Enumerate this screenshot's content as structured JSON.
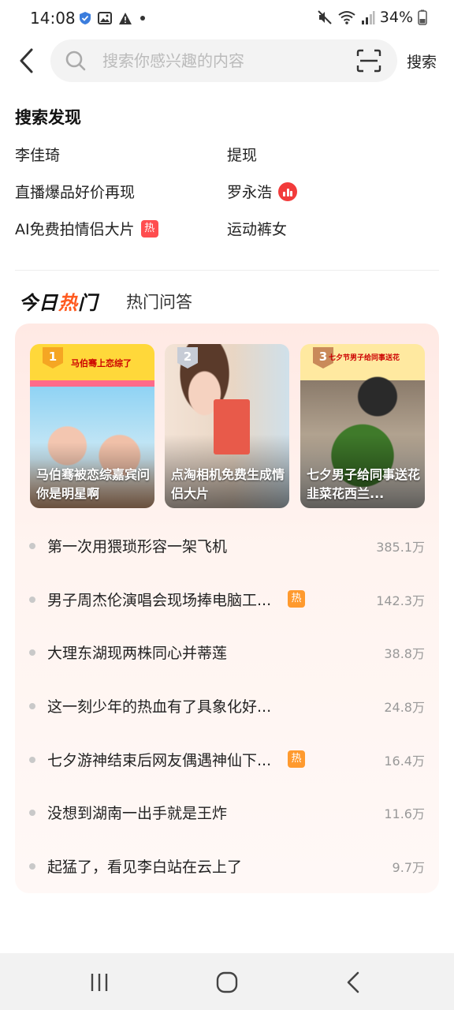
{
  "status_bar": {
    "time": "14:08",
    "battery": "34%",
    "left_icons": [
      "shield-icon",
      "image-icon",
      "warning-icon",
      "dot-icon"
    ],
    "right_icons": [
      "mute-icon",
      "wifi-icon",
      "signal-icon",
      "battery-icon"
    ]
  },
  "search": {
    "placeholder": "搜索你感兴趣的内容",
    "button_label": "搜索"
  },
  "discovery": {
    "title": "搜索发现",
    "items": [
      {
        "label": "李佳琦",
        "badge": ""
      },
      {
        "label": "提现",
        "badge": ""
      },
      {
        "label": "直播爆品好价再现",
        "badge": ""
      },
      {
        "label": "罗永浩",
        "badge": "live"
      },
      {
        "label": "AI免费拍情侣大片",
        "badge": "热"
      },
      {
        "label": "运动裤女",
        "badge": ""
      }
    ]
  },
  "tabs": {
    "active_part1": "今日",
    "active_part2": "热",
    "active_part3": "门",
    "inactive": "热门问答"
  },
  "hot_cards": [
    {
      "rank": "1",
      "title": "马伯骞被恋综嘉宾问你是明星啊",
      "top_text": "马伯骞上恋综了"
    },
    {
      "rank": "2",
      "title": "点淘相机免费生成情侣大片",
      "top_text": ""
    },
    {
      "rank": "3",
      "title": "七夕男子给同事送花韭菜花西兰...",
      "top_text": "七夕节男子给同事送花"
    }
  ],
  "hot_list": [
    {
      "title": "第一次用猥琐形容一架飞机",
      "count": "385.1万",
      "tag": ""
    },
    {
      "title": "男子周杰伦演唱会现场捧电脑工...",
      "count": "142.3万",
      "tag": "热"
    },
    {
      "title": "大理东湖现两株同心并蒂莲",
      "count": "38.8万",
      "tag": ""
    },
    {
      "title": "这一刻少年的热血有了具象化好...",
      "count": "24.8万",
      "tag": ""
    },
    {
      "title": "七夕游神结束后网友偶遇神仙下...",
      "count": "16.4万",
      "tag": "热"
    },
    {
      "title": "没想到湖南一出手就是王炸",
      "count": "11.6万",
      "tag": ""
    },
    {
      "title": "起猛了，看见李白站在云上了",
      "count": "9.7万",
      "tag": ""
    }
  ],
  "colors": {
    "accent": "#ff5a1f",
    "hot_badge": "#ff4d4f",
    "list_tag": "#ff9a2e"
  }
}
